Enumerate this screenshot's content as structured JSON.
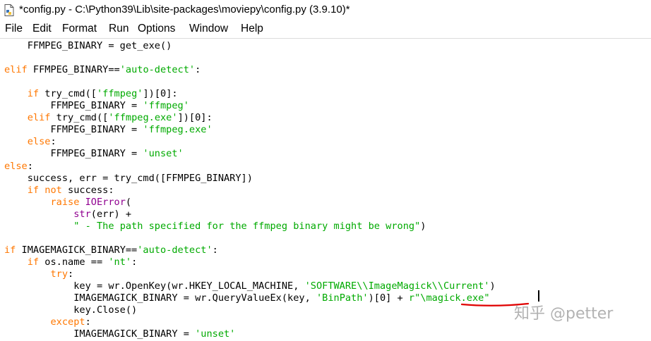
{
  "window": {
    "title": "*config.py - C:\\Python39\\Lib\\site-packages\\moviepy\\config.py (3.9.10)*"
  },
  "menu": {
    "items": [
      "File",
      "Edit",
      "Format",
      "Run",
      "Options",
      "Window",
      "Help"
    ]
  },
  "code": {
    "lines": [
      [
        [
          "",
          "    FFMPEG_BINARY = get_exe()"
        ]
      ],
      [
        [
          "",
          ""
        ]
      ],
      [
        [
          "kw",
          "elif"
        ],
        [
          "",
          " FFMPEG_BINARY=="
        ],
        [
          "st",
          "'auto-detect'"
        ],
        [
          "",
          ":"
        ]
      ],
      [
        [
          "",
          ""
        ]
      ],
      [
        [
          "",
          "    "
        ],
        [
          "kw",
          "if"
        ],
        [
          "",
          " try_cmd(["
        ],
        [
          "st",
          "'ffmpeg'"
        ],
        [
          "",
          "])[0]:"
        ]
      ],
      [
        [
          "",
          "        FFMPEG_BINARY = "
        ],
        [
          "st",
          "'ffmpeg'"
        ]
      ],
      [
        [
          "",
          "    "
        ],
        [
          "kw",
          "elif"
        ],
        [
          "",
          " try_cmd(["
        ],
        [
          "st",
          "'ffmpeg.exe'"
        ],
        [
          "",
          "])[0]:"
        ]
      ],
      [
        [
          "",
          "        FFMPEG_BINARY = "
        ],
        [
          "st",
          "'ffmpeg.exe'"
        ]
      ],
      [
        [
          "",
          "    "
        ],
        [
          "kw",
          "else"
        ],
        [
          "",
          ":"
        ]
      ],
      [
        [
          "",
          "        FFMPEG_BINARY = "
        ],
        [
          "st",
          "'unset'"
        ]
      ],
      [
        [
          "kw",
          "else"
        ],
        [
          "",
          ":"
        ]
      ],
      [
        [
          "",
          "    success, err = try_cmd([FFMPEG_BINARY])"
        ]
      ],
      [
        [
          "",
          "    "
        ],
        [
          "kw",
          "if not"
        ],
        [
          "",
          " success:"
        ]
      ],
      [
        [
          "",
          "        "
        ],
        [
          "kw",
          "raise"
        ],
        [
          "",
          " "
        ],
        [
          "bi",
          "IOError"
        ],
        [
          "",
          "("
        ]
      ],
      [
        [
          "",
          "            "
        ],
        [
          "bi",
          "str"
        ],
        [
          "",
          "(err) +"
        ]
      ],
      [
        [
          "",
          "            "
        ],
        [
          "st",
          "\" - The path specified for the ffmpeg binary might be wrong\""
        ],
        [
          "",
          ")"
        ]
      ],
      [
        [
          "",
          ""
        ]
      ],
      [
        [
          "kw",
          "if"
        ],
        [
          "",
          " IMAGEMAGICK_BINARY=="
        ],
        [
          "st",
          "'auto-detect'"
        ],
        [
          "",
          ":"
        ]
      ],
      [
        [
          "",
          "    "
        ],
        [
          "kw",
          "if"
        ],
        [
          "",
          " os.name == "
        ],
        [
          "st",
          "'nt'"
        ],
        [
          "",
          ":"
        ]
      ],
      [
        [
          "",
          "        "
        ],
        [
          "kw",
          "try"
        ],
        [
          "",
          ":"
        ]
      ],
      [
        [
          "",
          "            key = wr.OpenKey(wr.HKEY_LOCAL_MACHINE, "
        ],
        [
          "st",
          "'SOFTWARE\\\\ImageMagick\\\\Current'"
        ],
        [
          "",
          ")"
        ]
      ],
      [
        [
          "",
          "            IMAGEMAGICK_BINARY = wr.QueryValueEx(key, "
        ],
        [
          "st",
          "'BinPath'"
        ],
        [
          "",
          ")[0] + "
        ],
        [
          "st",
          "r\"\\magick.exe\""
        ]
      ],
      [
        [
          "",
          "            key.Close()"
        ]
      ],
      [
        [
          "",
          "        "
        ],
        [
          "kw",
          "except"
        ],
        [
          "",
          ":"
        ]
      ],
      [
        [
          "",
          "            IMAGEMAGICK_BINARY = "
        ],
        [
          "st",
          "'unset'"
        ]
      ]
    ]
  },
  "watermark": {
    "text": "知乎 @petter"
  },
  "colors": {
    "keyword": "#ff7700",
    "builtin": "#900090",
    "string": "#00aa00",
    "underline": "#e00000"
  },
  "icons": {
    "app": "python-file-icon"
  }
}
